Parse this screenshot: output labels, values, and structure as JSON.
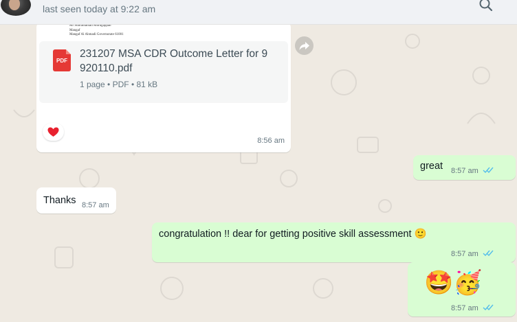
{
  "header": {
    "last_seen": "last seen today at 9:22 am",
    "search_icon": "search-icon"
  },
  "document_message": {
    "preview_lines": [
      "Mr Subramanian Murugappan",
      "Mangaf",
      "Mangaf Al Ahmadi Governorate 61001"
    ],
    "icon_label": "PDF",
    "file_name": "231207 MSA CDR Outcome Letter for 9920110.pdf",
    "file_name_line1": "231207 MSA CDR Outcome Letter for 9",
    "file_name_line2": "920110.pdf",
    "pages": "1 page",
    "type": "PDF",
    "size": "81 kB",
    "separator": "•",
    "time": "8:56 am",
    "reaction": "❤️"
  },
  "messages": [
    {
      "direction": "out",
      "text": "great",
      "time": "8:57 am",
      "status": "read"
    },
    {
      "direction": "in",
      "text": "Thanks",
      "time": "8:57 am"
    },
    {
      "direction": "out",
      "text": "congratulation !! dear for getting positive skill assessment 🙂",
      "time": "8:57 am",
      "status": "read"
    },
    {
      "direction": "out",
      "text": "🤩🥳",
      "time": "8:57 am",
      "status": "read"
    }
  ],
  "colors": {
    "chat_background": "#efeae2",
    "outgoing_bubble": "#d9fdd3",
    "incoming_bubble": "#ffffff",
    "read_ticks": "#53bdeb",
    "pdf_red": "#e53935"
  }
}
